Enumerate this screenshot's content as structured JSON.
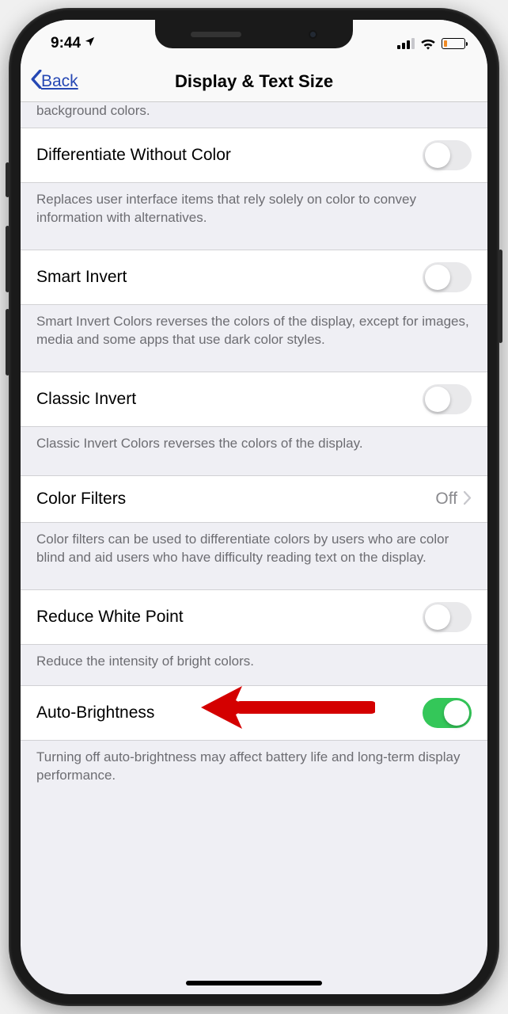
{
  "status": {
    "time": "9:44"
  },
  "nav": {
    "back_label": "Back",
    "title": "Display & Text Size"
  },
  "partial_desc": "background colors.",
  "rows": {
    "diff_without_color": {
      "label": "Differentiate Without Color",
      "desc": "Replaces user interface items that rely solely on color to convey information with alternatives.",
      "on": false
    },
    "smart_invert": {
      "label": "Smart Invert",
      "desc": "Smart Invert Colors reverses the colors of the display, except for images, media and some apps that use dark color styles.",
      "on": false
    },
    "classic_invert": {
      "label": "Classic Invert",
      "desc": "Classic Invert Colors reverses the colors of the display.",
      "on": false
    },
    "color_filters": {
      "label": "Color Filters",
      "value": "Off",
      "desc": "Color filters can be used to differentiate colors by users who are color blind and aid users who have difficulty reading text on the display."
    },
    "reduce_white_point": {
      "label": "Reduce White Point",
      "desc": "Reduce the intensity of bright colors.",
      "on": false
    },
    "auto_brightness": {
      "label": "Auto-Brightness",
      "desc": "Turning off auto-brightness may affect battery life and long-term display performance.",
      "on": true
    }
  }
}
